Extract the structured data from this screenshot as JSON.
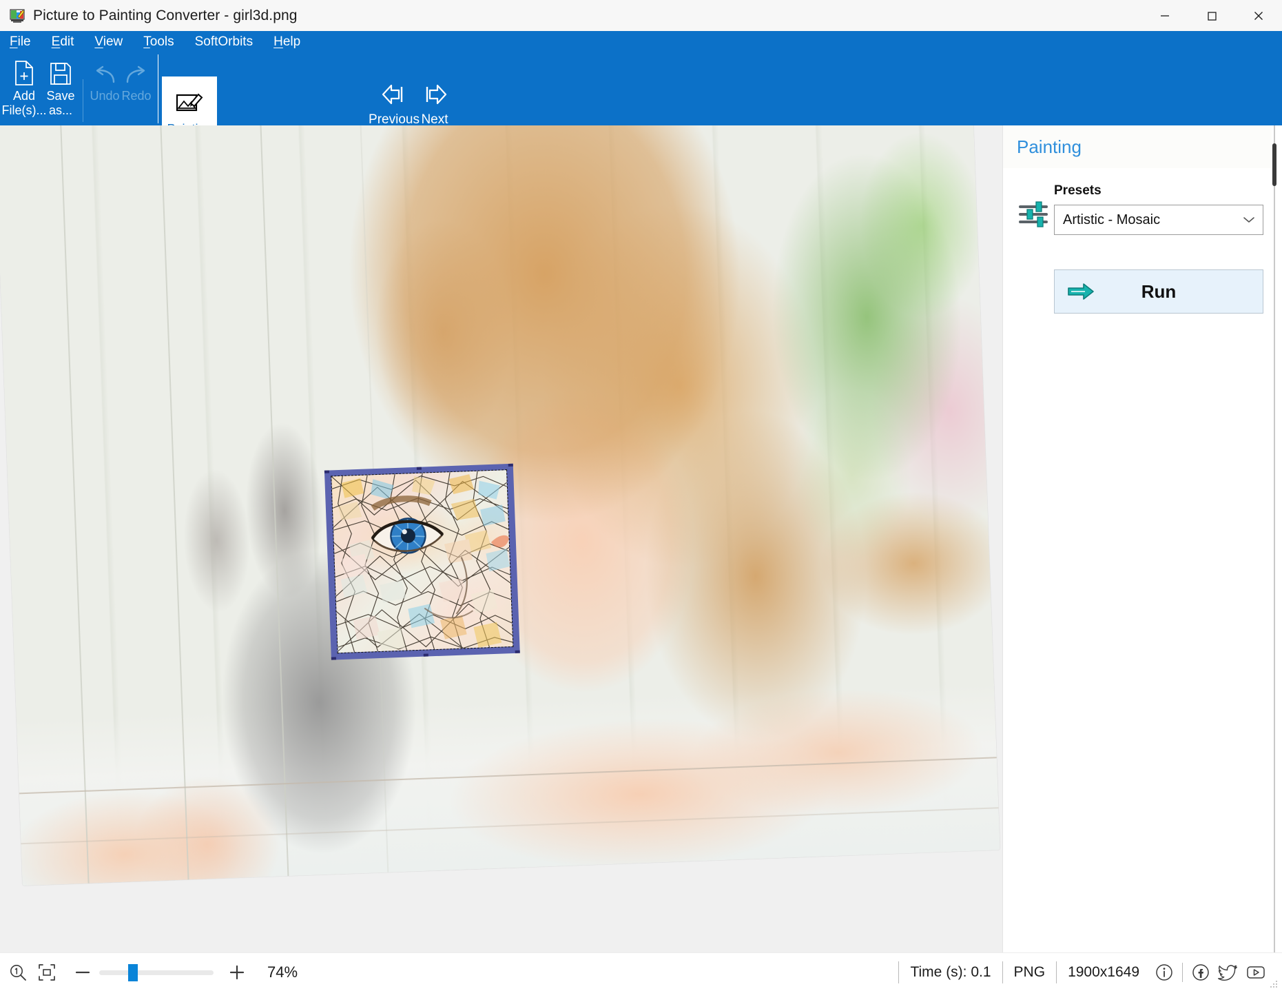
{
  "window": {
    "title": "Picture to Painting Converter - girl3d.png",
    "app_icon": "app-logo-icon",
    "minimize": "minimize-icon",
    "maximize": "maximize-icon",
    "close": "close-icon"
  },
  "menu": {
    "items": [
      {
        "accel": "F",
        "rest": "ile",
        "name": "file"
      },
      {
        "accel": "E",
        "rest": "dit",
        "name": "edit"
      },
      {
        "accel": "V",
        "rest": "iew",
        "name": "view"
      },
      {
        "accel": "T",
        "rest": "ools",
        "name": "tools"
      },
      {
        "accel": "",
        "rest": "SoftOrbits",
        "name": "softorbits"
      },
      {
        "accel": "H",
        "rest": "elp",
        "name": "help"
      }
    ]
  },
  "toolbar": {
    "add_files_label": "Add\nFile(s)...",
    "save_as_label": "Save\nas...",
    "undo_label": "Undo",
    "redo_label": "Redo",
    "painting_label": "Painting",
    "previous_label": "Previous",
    "next_label": "Next",
    "cart_icon": "shopping-cart-icon",
    "key_icon": "key-icon",
    "box_icon": "package-box-icon"
  },
  "panel": {
    "title": "Painting",
    "presets_label": "Presets",
    "preset_value": "Artistic - Mosaic",
    "preset_options": [
      "Artistic - Mosaic"
    ],
    "run_label": "Run"
  },
  "status": {
    "zoom_1to1_icon": "zoom-actual-size-icon",
    "fit_screen_icon": "fit-to-screen-icon",
    "zoom_out_label": "−",
    "zoom_in_label": "+",
    "zoom_percent": "74%",
    "zoom_value": 74,
    "slider_position_pct": 28,
    "time_label": "Time (s): 0.1",
    "format_label": "PNG",
    "dimensions_label": "1900x1649",
    "info_icon": "info-icon",
    "facebook_icon": "facebook-icon",
    "twitter_icon": "twitter-icon",
    "youtube_icon": "youtube-icon"
  },
  "colors": {
    "ribbon_blue": "#0c71c8",
    "accent_link": "#1676c8",
    "panel_title": "#2f8fdc",
    "run_bg": "#e7f2fb",
    "slider_thumb": "#0a84d8",
    "selection_border": "#5b63b0",
    "canvas_bg": "#f0f0f0"
  },
  "canvas": {
    "image_name": "girl3d.png",
    "alt": "Young girl with blonde hair resting on a white table next to a grey rabbit; a square mosaic-style preview overlay covers her left eye area"
  }
}
